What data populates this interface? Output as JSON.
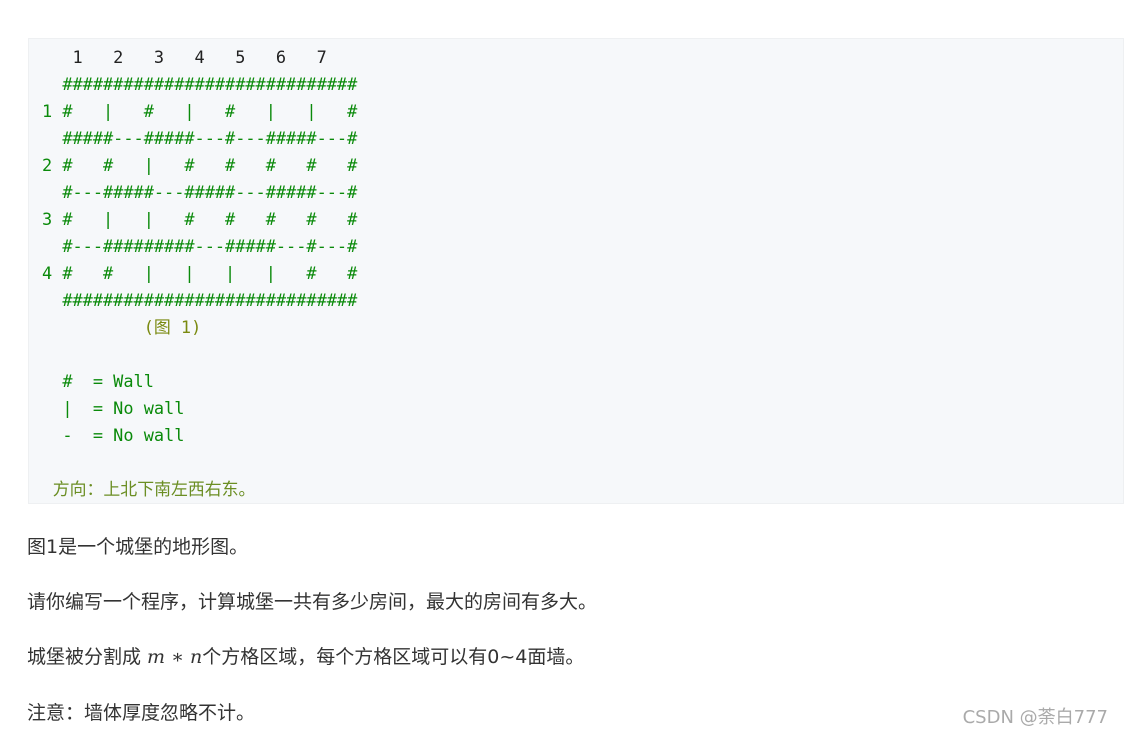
{
  "code_block": {
    "lines": [
      "   1   2   3   4   5   6   7",
      "  #############################",
      "1 #   |   #   |   #   |   |   #",
      "  #####---#####---#---#####---#",
      "2 #   #   |   #   #   #   #   #",
      "  #---#####---#####---#####---#",
      "3 #   |   |   #   #   #   #   #",
      "  #---#########---#####---#---#",
      "4 #   #   |   |   |   |   #   #",
      "  #############################",
      "          (图 1)",
      "",
      "  #  = Wall",
      "  |  = No wall",
      "  -  = No wall",
      "",
      "  方向：上北下南左西右东。"
    ]
  },
  "paragraphs": {
    "p1": "图1是一个城堡的地形图。",
    "p2": "请你编写一个程序，计算城堡一共有多少房间，最大的房间有多大。",
    "p3_before": "城堡被分割成 ",
    "p3_math": "m ∗ n",
    "p3_after": "个方格区域，每个方格区域可以有0~4面墙。",
    "p4": "注意：墙体厚度忽略不计。"
  },
  "watermark": "CSDN @荼白777"
}
